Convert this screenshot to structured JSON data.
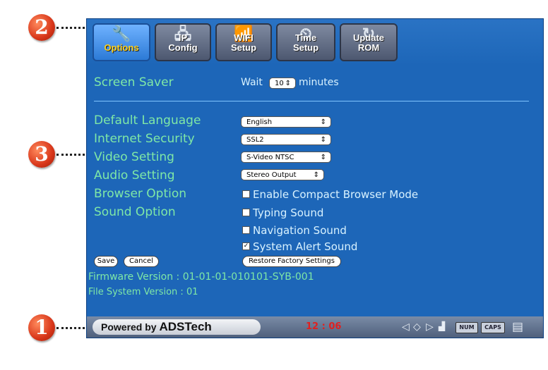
{
  "callouts": [
    "2",
    "3",
    "1"
  ],
  "tabs": [
    {
      "label": "Options",
      "icon": "wrench-icon",
      "glyph": "🔧",
      "active": true
    },
    {
      "label": "IP\nConfig",
      "icon": "network-icon",
      "glyph": "🖧",
      "active": false
    },
    {
      "label": "WIFI\nSetup",
      "icon": "wifi-router-icon",
      "glyph": "📶",
      "active": false
    },
    {
      "label": "Time\nSetup",
      "icon": "clock-icon",
      "glyph": "⏲",
      "active": false
    },
    {
      "label": "Update\nROM",
      "icon": "update-icon",
      "glyph": "↻",
      "active": false
    }
  ],
  "screen_saver": {
    "label": "Screen Saver",
    "wait": "Wait",
    "value": "10",
    "unit": "minutes"
  },
  "settings": [
    {
      "label": "Default Language",
      "value": "English"
    },
    {
      "label": "Internet Security",
      "value": "SSL2"
    },
    {
      "label": "Video Setting",
      "value": "S-Video NTSC"
    },
    {
      "label": "Audio Setting",
      "value": "Stereo Output"
    },
    {
      "label": "Browser Option"
    },
    {
      "label": "Sound Option"
    }
  ],
  "checkboxes": [
    {
      "label": "Enable Compact Browser Mode",
      "checked": false
    },
    {
      "label": "Typing Sound",
      "checked": false
    },
    {
      "label": "Navigation Sound",
      "checked": false
    },
    {
      "label": "System Alert Sound",
      "checked": true
    }
  ],
  "buttons": {
    "save": "Save",
    "cancel": "Cancel",
    "restore": "Restore Factory Settings"
  },
  "info": {
    "firmware": "Firmware Version : 01-01-01-010101-SYB-001",
    "filesystem": "File System Version : 01"
  },
  "status_bar": {
    "powered_by": "Powered by",
    "brand": "ADSTech",
    "time": "12 : 06",
    "num": "NUM",
    "caps": "CAPS"
  },
  "colors": {
    "screen_bg": "#1d66b8",
    "label_green": "#7fe8a6",
    "callout_red": "#d8361a",
    "clock_red": "#e02020"
  }
}
